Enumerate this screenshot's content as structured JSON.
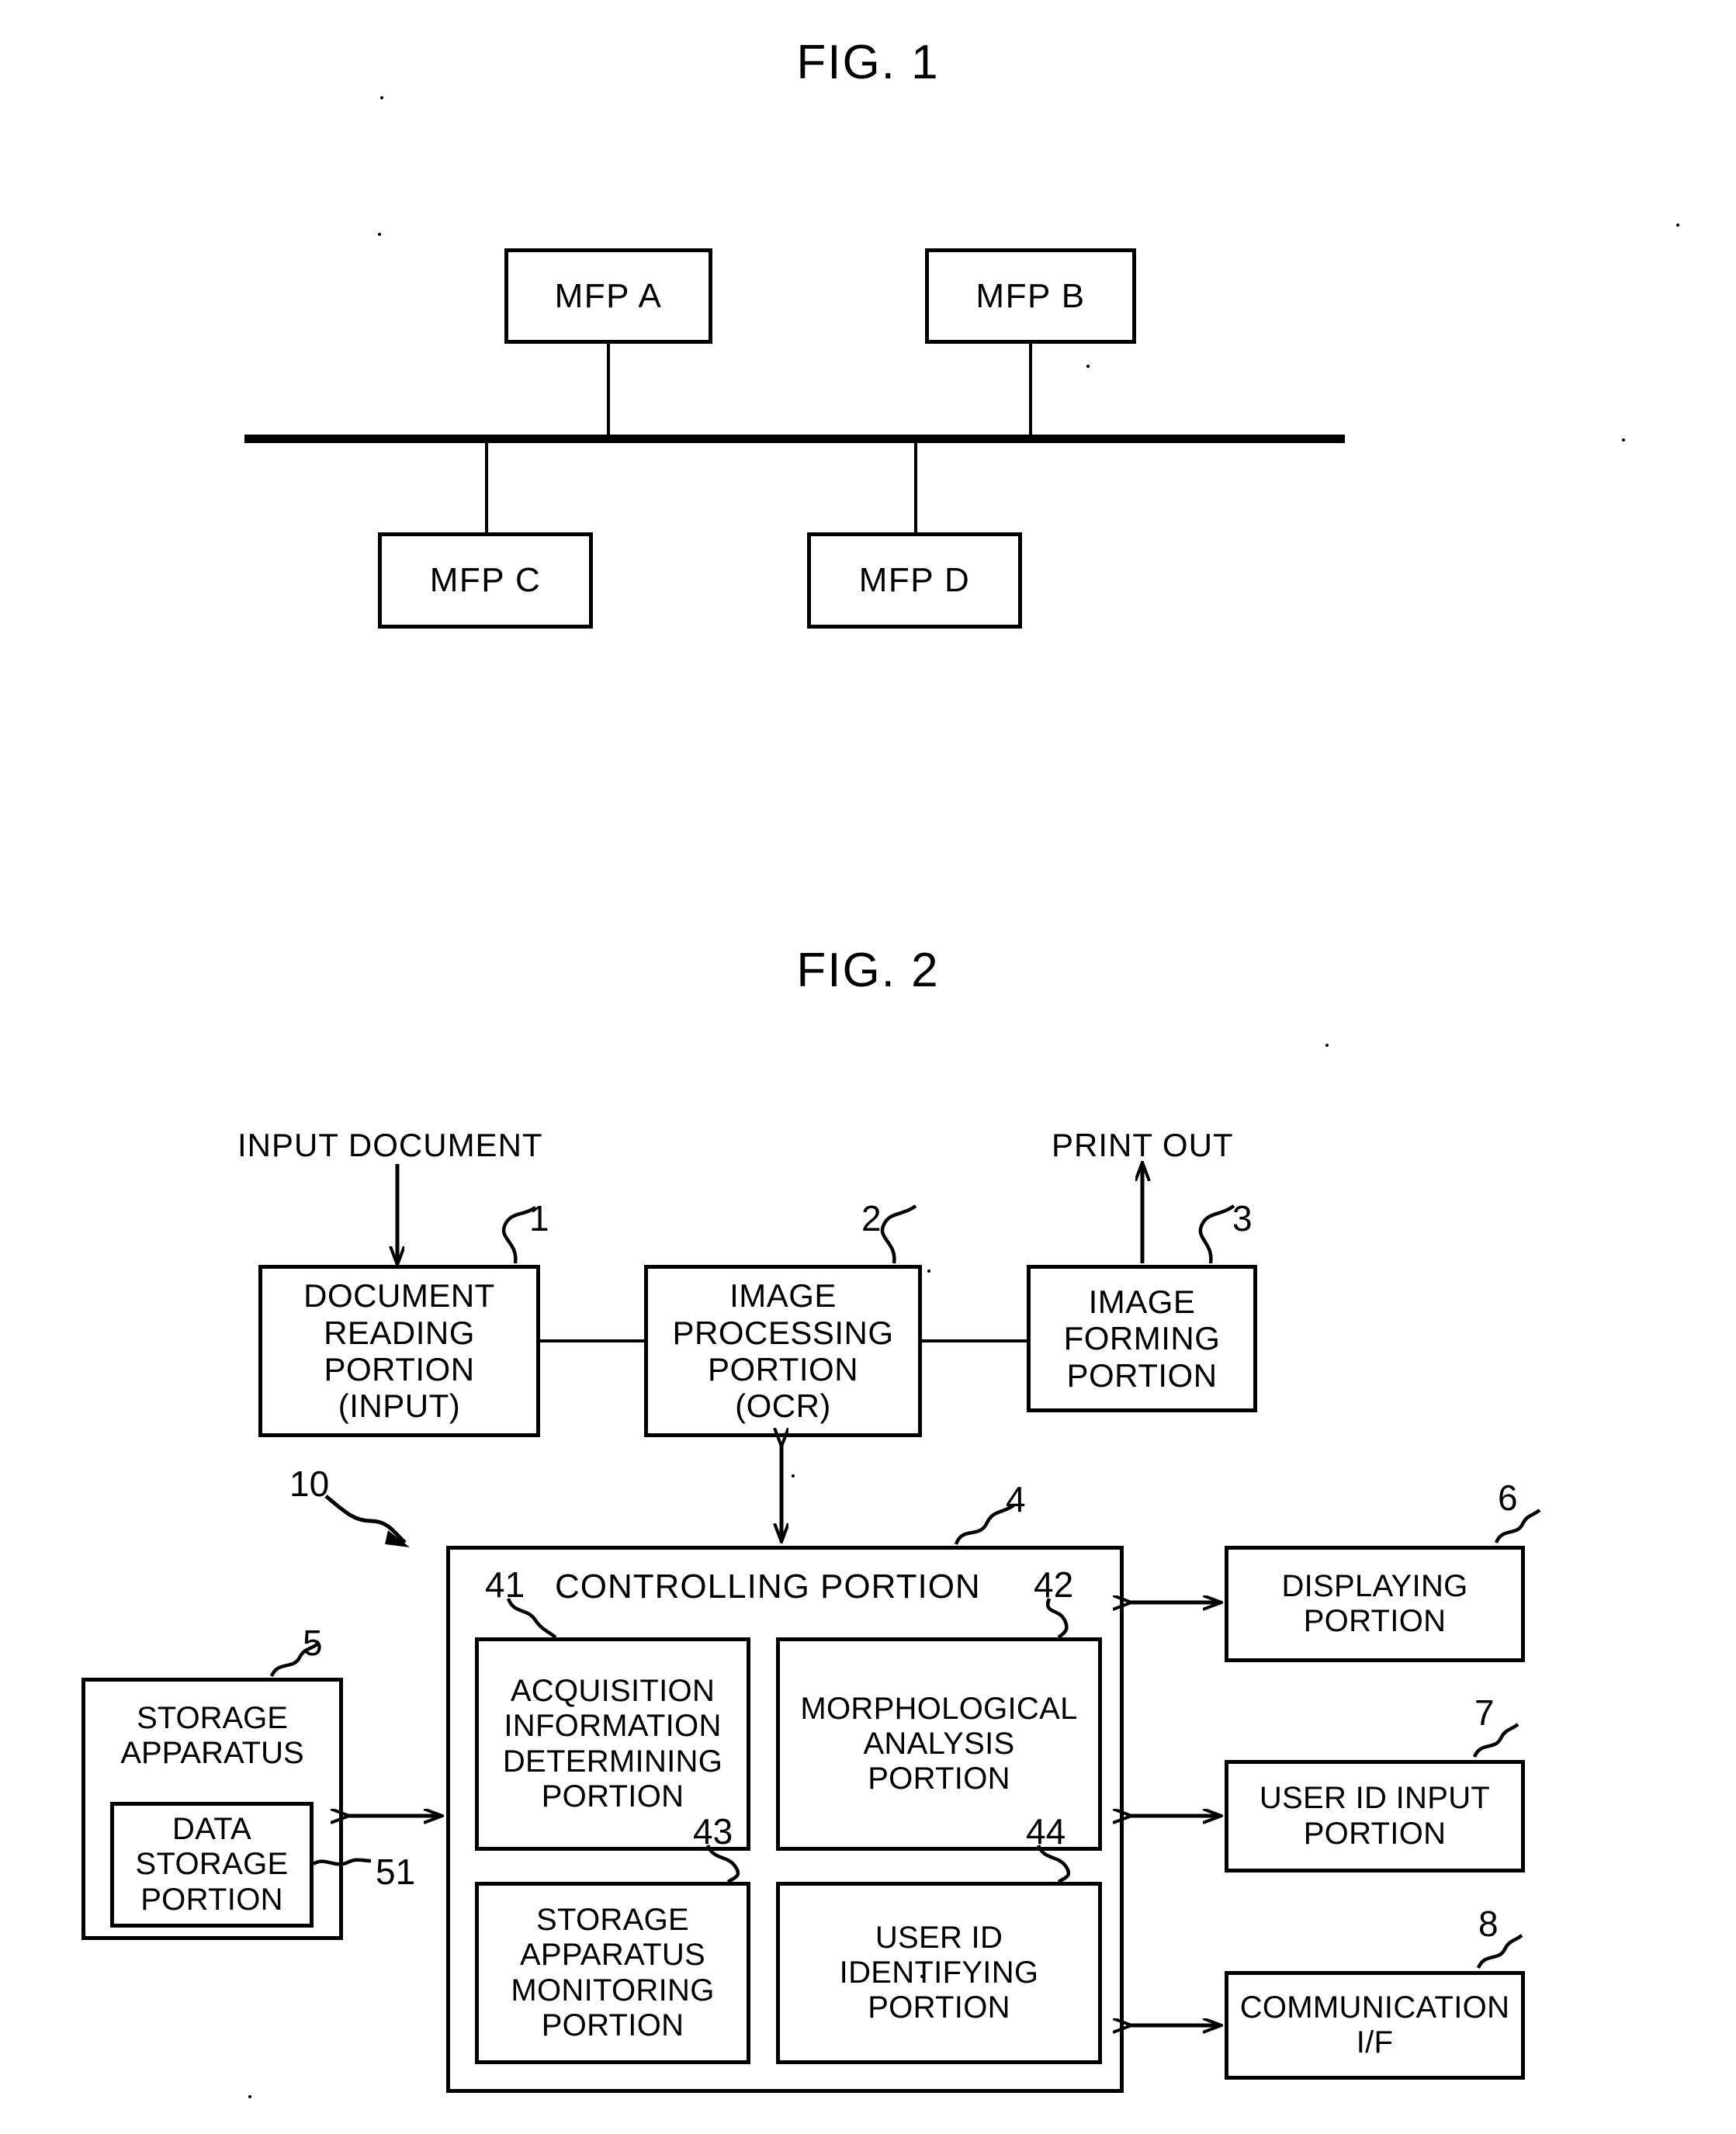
{
  "figures": [
    {
      "id": "fig1",
      "title": "FIG. 1",
      "nodes": [
        {
          "key": "mfp_a",
          "label": "MFP A"
        },
        {
          "key": "mfp_b",
          "label": "MFP B"
        },
        {
          "key": "mfp_c",
          "label": "MFP C"
        },
        {
          "key": "mfp_d",
          "label": "MFP D"
        }
      ]
    },
    {
      "id": "fig2",
      "title": "FIG. 2",
      "flow_labels": {
        "input": "INPUT DOCUMENT",
        "output": "PRINT OUT"
      },
      "blocks": [
        {
          "ref": "1",
          "key": "document_reading_portion",
          "label": "DOCUMENT\nREADING\nPORTION\n(INPUT)"
        },
        {
          "ref": "2",
          "key": "image_processing_portion",
          "label": "IMAGE\nPROCESSING\nPORTION\n(OCR)"
        },
        {
          "ref": "3",
          "key": "image_forming_portion",
          "label": "IMAGE\nFORMING\nPORTION"
        },
        {
          "ref": "4",
          "key": "controlling_portion",
          "label": "CONTROLLING PORTION"
        },
        {
          "ref": "5",
          "key": "storage_apparatus",
          "label": "STORAGE\nAPPARATUS"
        },
        {
          "ref": "51",
          "key": "data_storage_portion",
          "label": "DATA\nSTORAGE\nPORTION"
        },
        {
          "ref": "6",
          "key": "displaying_portion",
          "label": "DISPLAYING\nPORTION"
        },
        {
          "ref": "7",
          "key": "user_id_input_portion",
          "label": "USER ID INPUT\nPORTION"
        },
        {
          "ref": "8",
          "key": "communication_if",
          "label": "COMMUNICATION\nI/F"
        },
        {
          "ref": "41",
          "key": "acquisition_information_determining_portion",
          "label": "ACQUISITION\nINFORMATION\nDETERMINING\nPORTION"
        },
        {
          "ref": "42",
          "key": "morphological_analysis_portion",
          "label": "MORPHOLOGICAL\nANALYSIS\nPORTION"
        },
        {
          "ref": "43",
          "key": "storage_apparatus_monitoring_portion",
          "label": "STORAGE\nAPPARATUS\nMONITORING\nPORTION"
        },
        {
          "ref": "44",
          "key": "user_id_identifying_portion",
          "label": "USER ID\nIDENTIFYING\nPORTION"
        },
        {
          "ref": "10",
          "key": "apparatus_assembly",
          "label": ""
        }
      ],
      "reference_numerals": {
        "one": "1",
        "two": "2",
        "three": "3",
        "four": "4",
        "five": "5",
        "six": "6",
        "seven": "7",
        "eight": "8",
        "ten": "10",
        "fortyone": "41",
        "fortytwo": "42",
        "fortythree": "43",
        "fortyfour": "44",
        "fiftyone": "51"
      }
    }
  ],
  "colors": {
    "ink": "#000000",
    "paper": "#ffffff"
  }
}
